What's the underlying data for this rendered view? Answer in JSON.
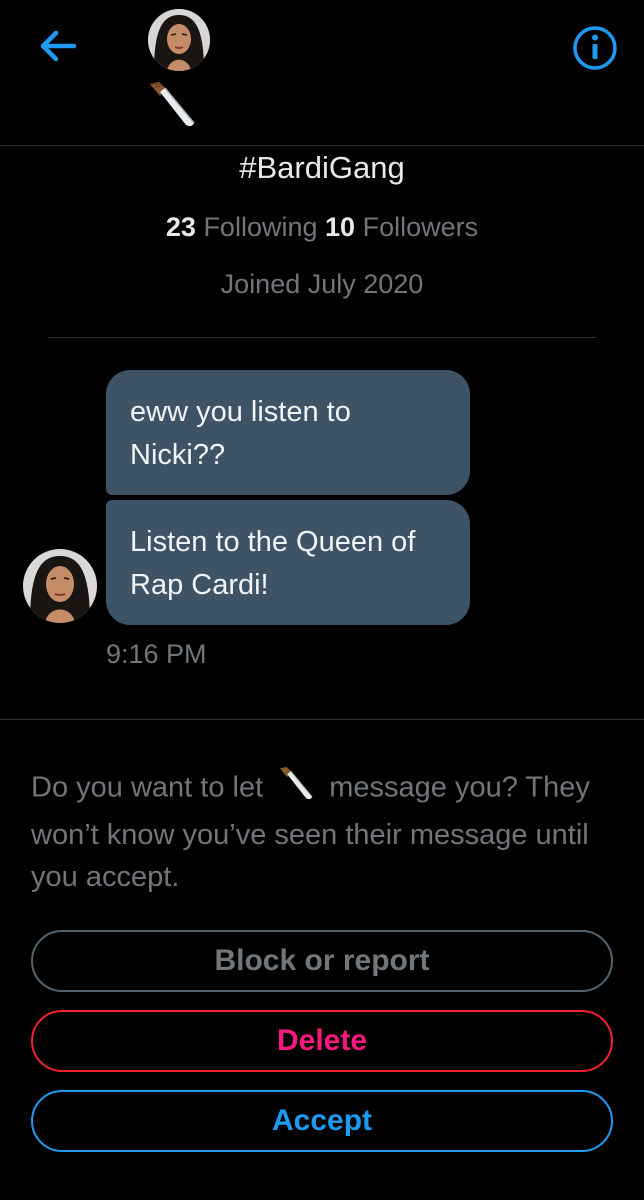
{
  "header": {
    "back_icon": "arrow-left-icon",
    "avatar_icon": "user-avatar",
    "display_name_icon": "kitchen-knife-emoji",
    "info_icon": "info-circle-icon",
    "accent_color": "#1d9bf0"
  },
  "profile": {
    "name": "#BardiGang",
    "following_count": "23",
    "following_label": "Following",
    "followers_count": "10",
    "followers_label": "Followers",
    "joined": "Joined July 2020"
  },
  "conversation": {
    "messages": [
      {
        "text": "eww you listen to Nicki??"
      },
      {
        "text": "Listen to the Queen of Rap Cardi!"
      }
    ],
    "timestamp": "9:16 PM",
    "bubble_color": "#3e5366"
  },
  "request": {
    "prompt_before": "Do you want to let",
    "prompt_icon": "kitchen-knife-emoji",
    "prompt_after": "message you? They won’t know you’ve seen their message until you accept.",
    "block_label": "Block or report",
    "delete_label": "Delete",
    "accept_label": "Accept",
    "delete_color": "#f91880",
    "accept_color": "#1d9bf0"
  }
}
